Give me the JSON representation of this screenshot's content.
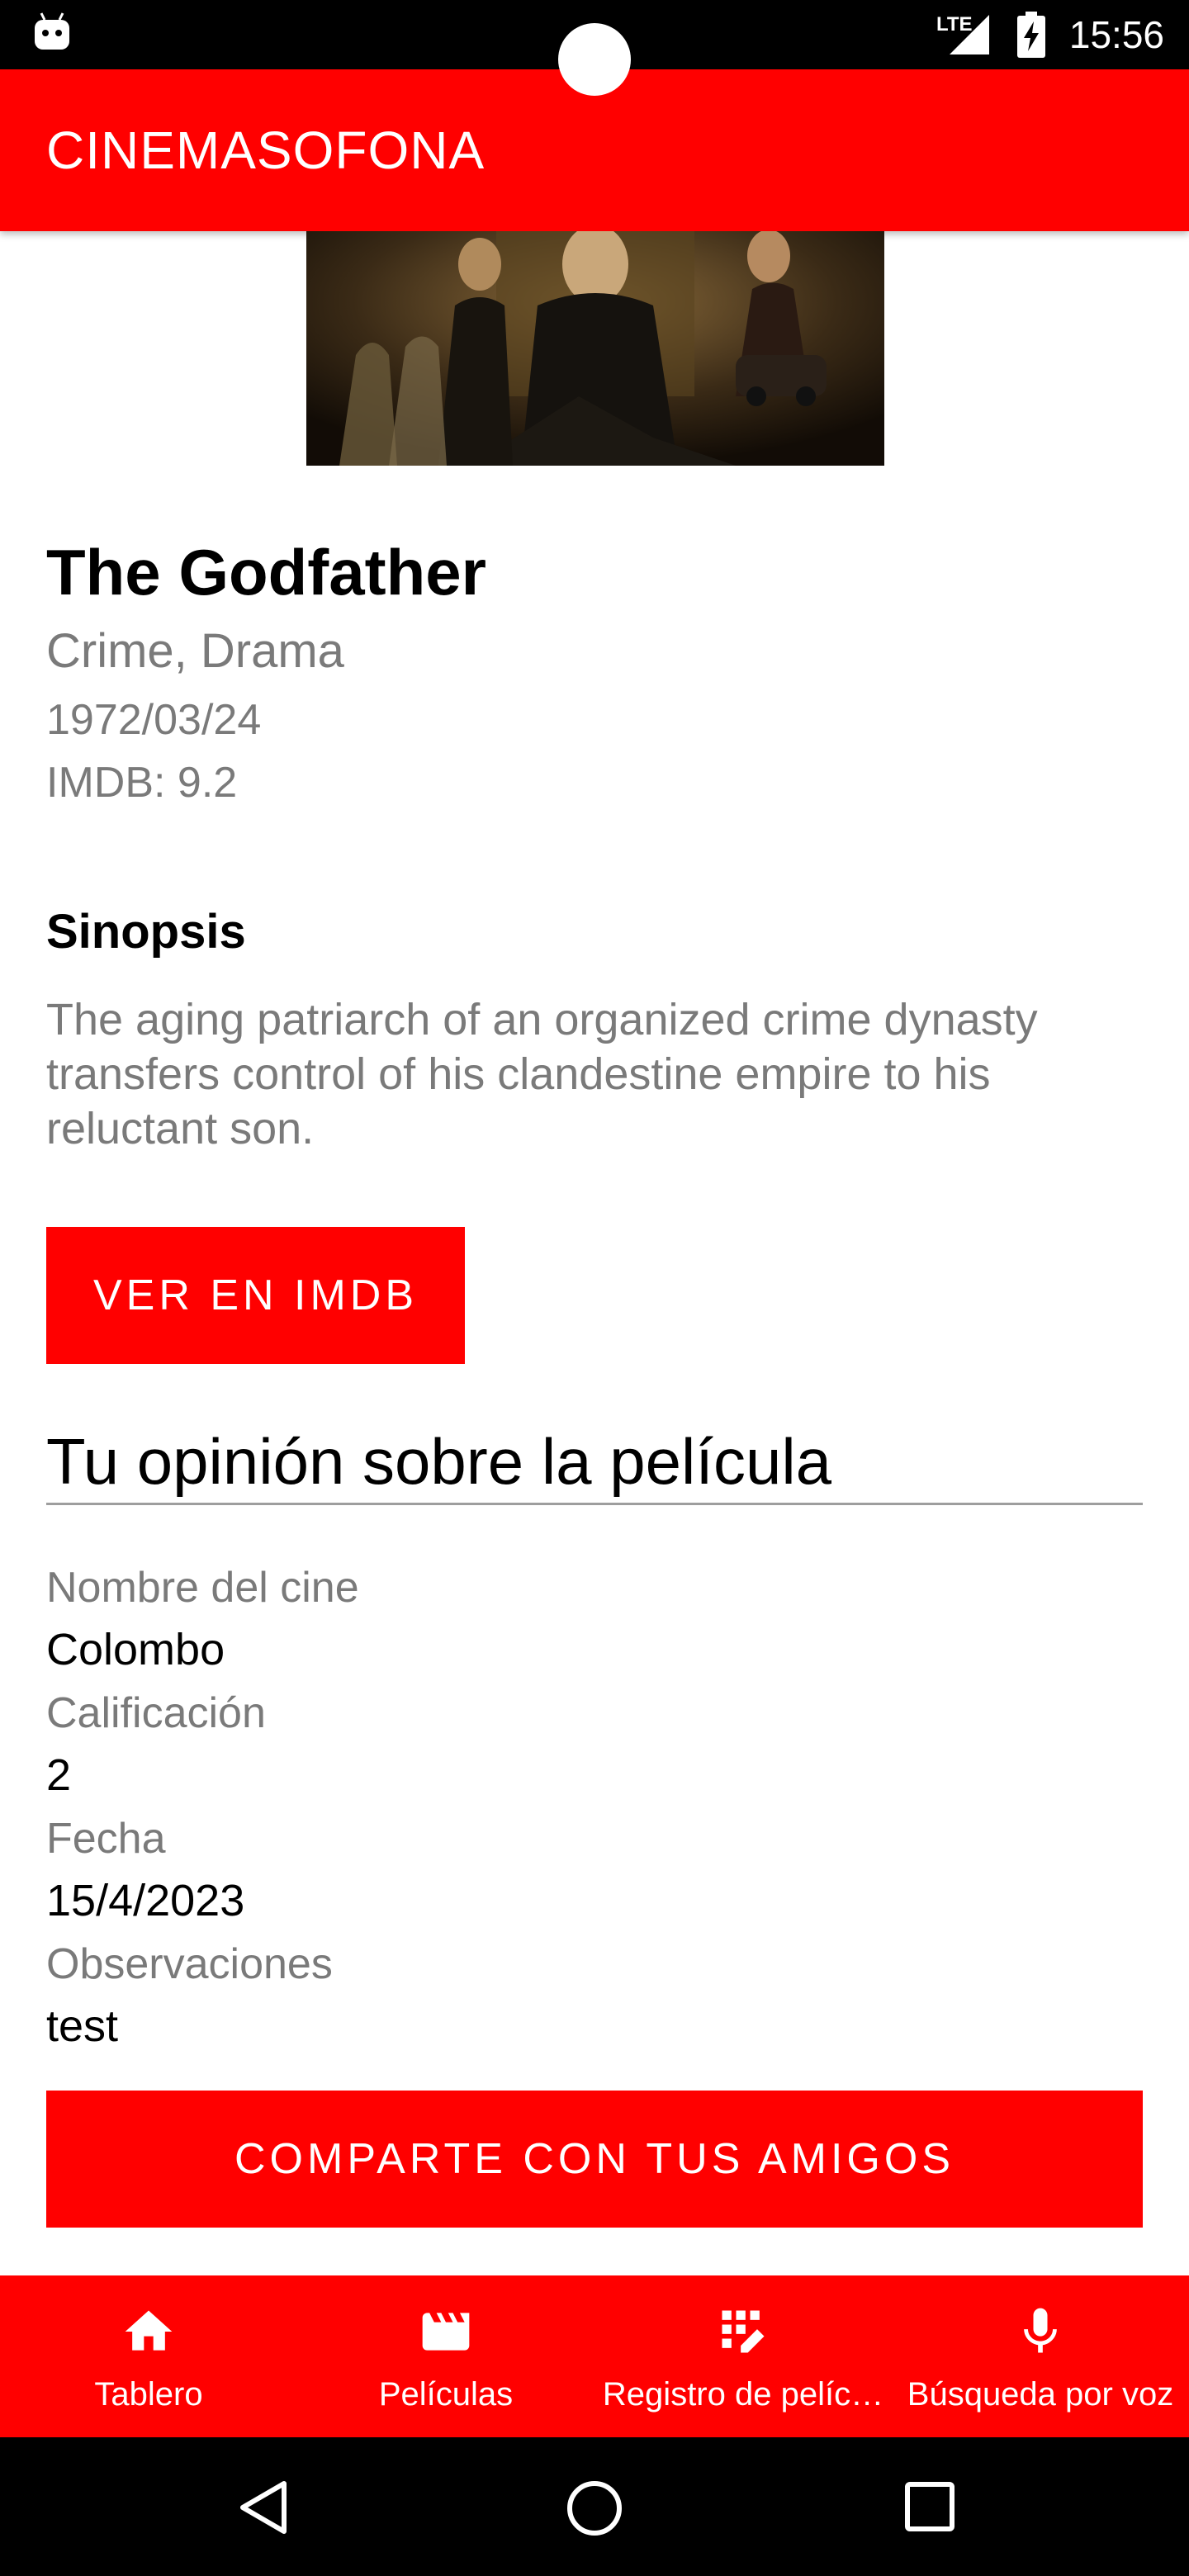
{
  "status_bar": {
    "time": "15:56",
    "network": "LTE"
  },
  "app_bar": {
    "title": "CINEMASOFONA"
  },
  "movie": {
    "title": "The Godfather",
    "genres": "Crime, Drama",
    "release_date": "1972/03/24",
    "rating": "IMDB: 9.2"
  },
  "synopsis": {
    "heading": "Sinopsis",
    "text": "The aging patriarch of an organized crime dynasty transfers control of his clandestine empire to his reluctant son."
  },
  "buttons": {
    "imdb": "VER EN IMDB",
    "share": "COMPARTE CON TUS AMIGOS"
  },
  "opinion": {
    "heading": "Tu opinión sobre la película",
    "fields": [
      {
        "label": "Nombre del cine",
        "value": "Colombo"
      },
      {
        "label": "Calificación",
        "value": "2"
      },
      {
        "label": "Fecha",
        "value": "15/4/2023"
      },
      {
        "label": "Observaciones",
        "value": "test"
      }
    ]
  },
  "bottom_nav": {
    "items": [
      {
        "label": "Tablero",
        "icon": "home-icon"
      },
      {
        "label": "Películas",
        "icon": "movie-clapper-icon"
      },
      {
        "label": "Registro de pelíc…",
        "icon": "edit-grid-icon"
      },
      {
        "label": "Búsqueda por voz",
        "icon": "microphone-icon"
      }
    ]
  },
  "colors": {
    "primary": "#ff0000",
    "secondary_text": "#7a7a7a"
  }
}
